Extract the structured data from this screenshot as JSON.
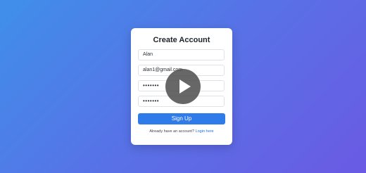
{
  "form": {
    "title": "Create Account",
    "name_value": "Alan",
    "email_value": "alan1@gmail.com",
    "password_value": "•••••••",
    "confirm_password_value": "•••••••",
    "submit_label": "Sign Up",
    "footer_text": "Already have an account?",
    "login_link": "Login here"
  },
  "overlay": {
    "icon": "play-icon"
  },
  "colors": {
    "accent": "#2f7bea",
    "link": "#1f6fe0",
    "background_start": "#3f8fea",
    "background_end": "#6a5ae4"
  }
}
